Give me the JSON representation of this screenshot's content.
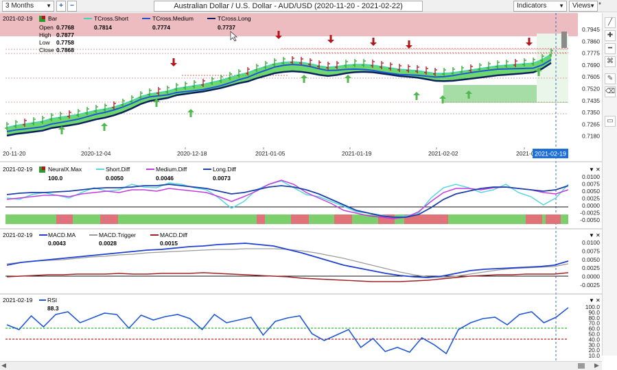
{
  "toolbar": {
    "range": "3 Months",
    "zoom_in": "+",
    "zoom_out": "−",
    "title": "Australian Dollar / U.S. Dollar - AUD/USD (2020-11-20 - 2021-02-22)",
    "indicators": "Indicators",
    "views": "Views",
    "star": "*"
  },
  "icons": [
    "line-tool-icon",
    "crosshair-icon",
    "hline-icon",
    "magnet-icon",
    "pen-icon",
    "erase-icon",
    "comment-icon"
  ],
  "price_pane": {
    "date": "2021-02-19",
    "bar_label": "Bar",
    "ohlc": [
      {
        "label": "Open",
        "value": "0.7768"
      },
      {
        "label": "High",
        "value": "0.7877"
      },
      {
        "label": "Low",
        "value": "0.7758"
      },
      {
        "label": "Close",
        "value": "0.7868"
      }
    ],
    "legend": [
      {
        "name": "TCross.Short",
        "value": "0.7814",
        "color": "#3fd6b8"
      },
      {
        "name": "TCross.Medium",
        "value": "0.7774",
        "color": "#1f56d8"
      },
      {
        "name": "TCross.Long",
        "value": "0.7737",
        "color": "#0a1f5c"
      }
    ],
    "y_ticks": [
      "0.7945",
      "0.7860",
      "0.7775",
      "0.7690",
      "0.7605",
      "0.7520",
      "0.7435",
      "0.7350",
      "0.7265",
      "0.7180"
    ],
    "x_ticks": [
      "20-11-20",
      "2020-12-04",
      "2020-12-18",
      "2021-01-05",
      "2021-01-19",
      "2021-02-02",
      "2021-0"
    ],
    "cursor_date": "2021-02-19"
  },
  "neural_pane": {
    "date": "2021-02-19",
    "legend": [
      {
        "name": "NeuralX.Max",
        "value": "100.0",
        "color": "#2e9a2e"
      },
      {
        "name": "Short.Diff",
        "value": "0.0050",
        "color": "#55d6e0"
      },
      {
        "name": "Medium.Diff",
        "value": "0.0046",
        "color": "#c23be0"
      },
      {
        "name": "Long.Diff",
        "value": "0.0073",
        "color": "#1c3fa8"
      }
    ],
    "y_ticks": [
      "0.0100",
      "0.0075",
      "0.0050",
      "0.0025",
      "0.0000",
      "-0.0025",
      "-0.0050"
    ]
  },
  "macd_pane": {
    "date": "2021-02-19",
    "legend": [
      {
        "name": "MACD.MA",
        "value": "0.0043",
        "color": "#1f3fd0"
      },
      {
        "name": "MACD.Trigger",
        "value": "0.0028",
        "color": "#9a9a9a"
      },
      {
        "name": "MACD.Diff",
        "value": "0.0015",
        "color": "#a02020"
      }
    ],
    "y_ticks": [
      "0.0100",
      "0.0075",
      "0.0050",
      "0.0025",
      "0.0000",
      "-0.0025"
    ]
  },
  "rsi_pane": {
    "date": "2021-02-19",
    "legend": [
      {
        "name": "RSI",
        "value": "88.3",
        "color": "#1f56d8"
      }
    ],
    "y_ticks": [
      "100.0",
      "90.0",
      "80.0",
      "70.0",
      "60.0",
      "50.0",
      "40.0",
      "30.0",
      "20.0",
      "10.0"
    ]
  },
  "pane_controls": {
    "collapse": "▼",
    "close": "✕"
  },
  "colors": {
    "up_arrow": "#4fb84f",
    "down_arrow": "#b3161b",
    "band": "#3ec93e",
    "resistance_zone": "#e3a0a6",
    "support_zone": "#7fcf7f",
    "neural_up": "#7ccf6c",
    "neural_down": "#e0737a"
  }
}
